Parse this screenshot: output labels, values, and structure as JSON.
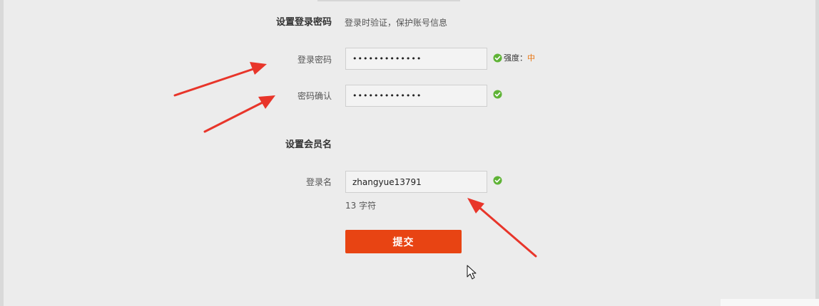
{
  "password_section": {
    "title": "设置登录密码",
    "hint": "登录时验证，保护账号信息",
    "password_label": "登录密码",
    "password_value": "•••••••••••••",
    "strength_label": "强度：",
    "strength_value": "中",
    "confirm_label": "密码确认",
    "confirm_value": "•••••••••••••"
  },
  "member_section": {
    "title": "设置会员名",
    "login_name_label": "登录名",
    "login_name_value": "zhangyue13791",
    "char_count": "13 字符"
  },
  "submit_label": "提交",
  "colors": {
    "accent": "#e84413",
    "success": "#5fb336",
    "strength_medium": "#e8720c",
    "annotation_arrow": "#e8352a"
  }
}
